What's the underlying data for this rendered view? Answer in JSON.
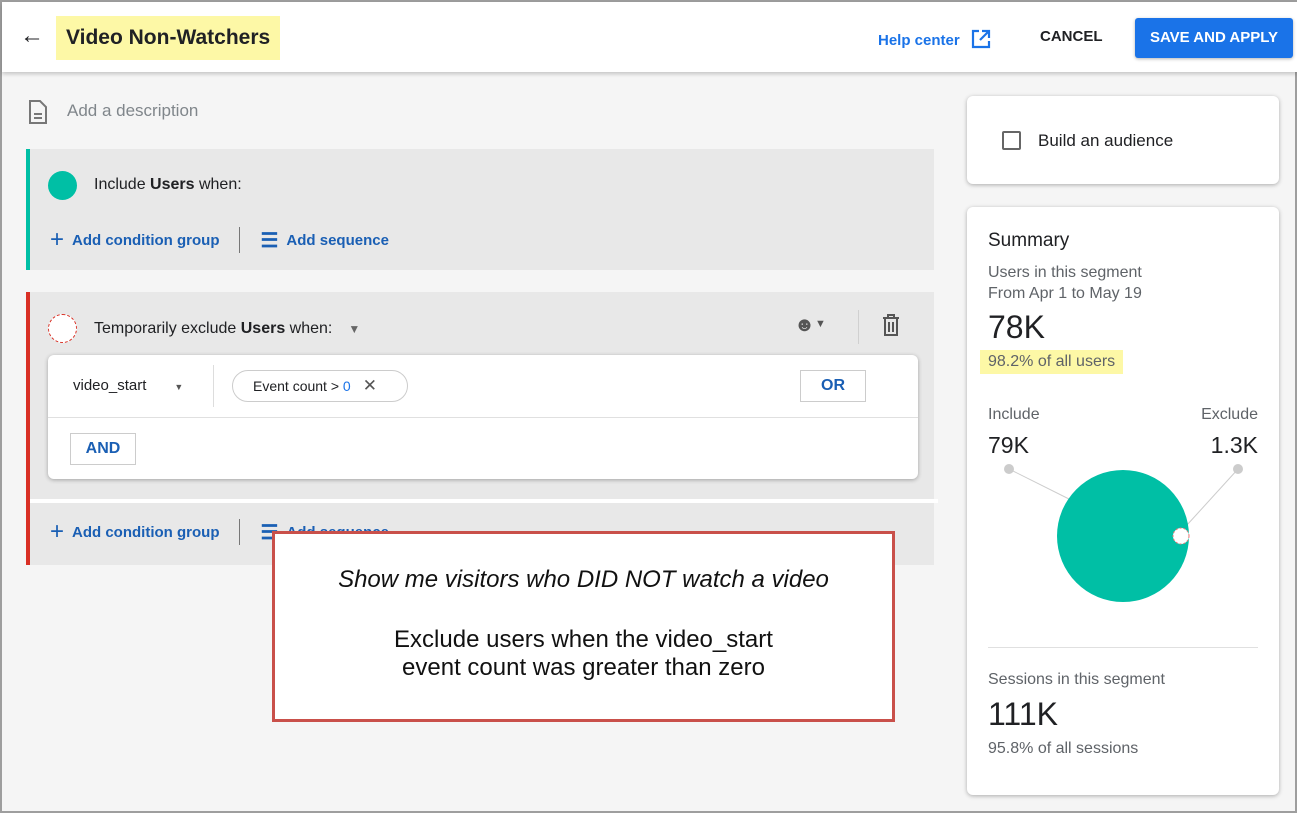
{
  "header": {
    "title": "Video Non-Watchers",
    "help_label": "Help center",
    "cancel_label": "CANCEL",
    "save_label": "SAVE AND APPLY"
  },
  "description_placeholder": "Add a description",
  "include_group": {
    "prefix": "Include ",
    "entity": "Users",
    "suffix": " when:",
    "add_condition_group": "Add condition group",
    "add_sequence": "Add sequence",
    "color": "#00bfa5"
  },
  "exclude_group": {
    "prefix": "Temporarily exclude ",
    "entity": "Users",
    "suffix": " when:",
    "color": "#d93025",
    "condition": {
      "event": "video_start",
      "chip_label": "Event count > ",
      "chip_value": "0",
      "or_label": "OR",
      "and_label": "AND"
    },
    "add_condition_group": "Add condition group",
    "add_sequence": "Add sequence"
  },
  "annotation": {
    "line1": "Show me visitors who DID NOT watch a video",
    "line2": "Exclude users when the video_start",
    "line3": "event count was greater than zero"
  },
  "audience": {
    "label": "Build an audience",
    "checked": false
  },
  "summary": {
    "title": "Summary",
    "users_label": "Users in this segment",
    "date_range": "From Apr 1 to May 19",
    "users_value": "78K",
    "users_pct": "98.2% of all users",
    "include_label": "Include",
    "include_value": "79K",
    "exclude_label": "Exclude",
    "exclude_value": "1.3K",
    "sessions_label": "Sessions in this segment",
    "sessions_value": "111K",
    "sessions_pct": "95.8% of all sessions"
  }
}
